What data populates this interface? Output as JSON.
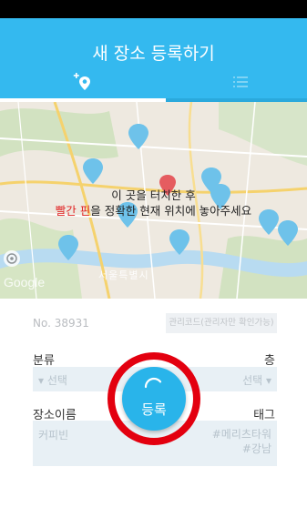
{
  "header": {
    "title": "새 장소 등록하기",
    "tabs": [
      {
        "name": "add-place",
        "icon": "add-location-icon",
        "active": true
      },
      {
        "name": "list",
        "icon": "list-icon",
        "active": false
      }
    ],
    "accent_color": "#34b9ef"
  },
  "map": {
    "hint_line1": "이 곳을 터치한 후",
    "hint_red": "빨간 핀",
    "hint_rest": "을 정확한 현재 위치에 놓아주세요",
    "city_label": "서울특별시",
    "logo": "Google"
  },
  "form": {
    "number": "No. 38931",
    "mgmt_code_placeholder": "관리코드(관리자만 확인가능)",
    "category_label": "분류",
    "floor_label": "층",
    "category_select": "▾ 선택",
    "floor_select": "선택 ▾",
    "place_name_label": "장소이름",
    "tag_label": "태그",
    "place_name_placeholder": "커피빈",
    "tag_placeholder_line1": "#메리츠타워",
    "tag_placeholder_line2": "#강남"
  },
  "register_button": {
    "label": "등록",
    "highlight_color": "#e3000f"
  }
}
